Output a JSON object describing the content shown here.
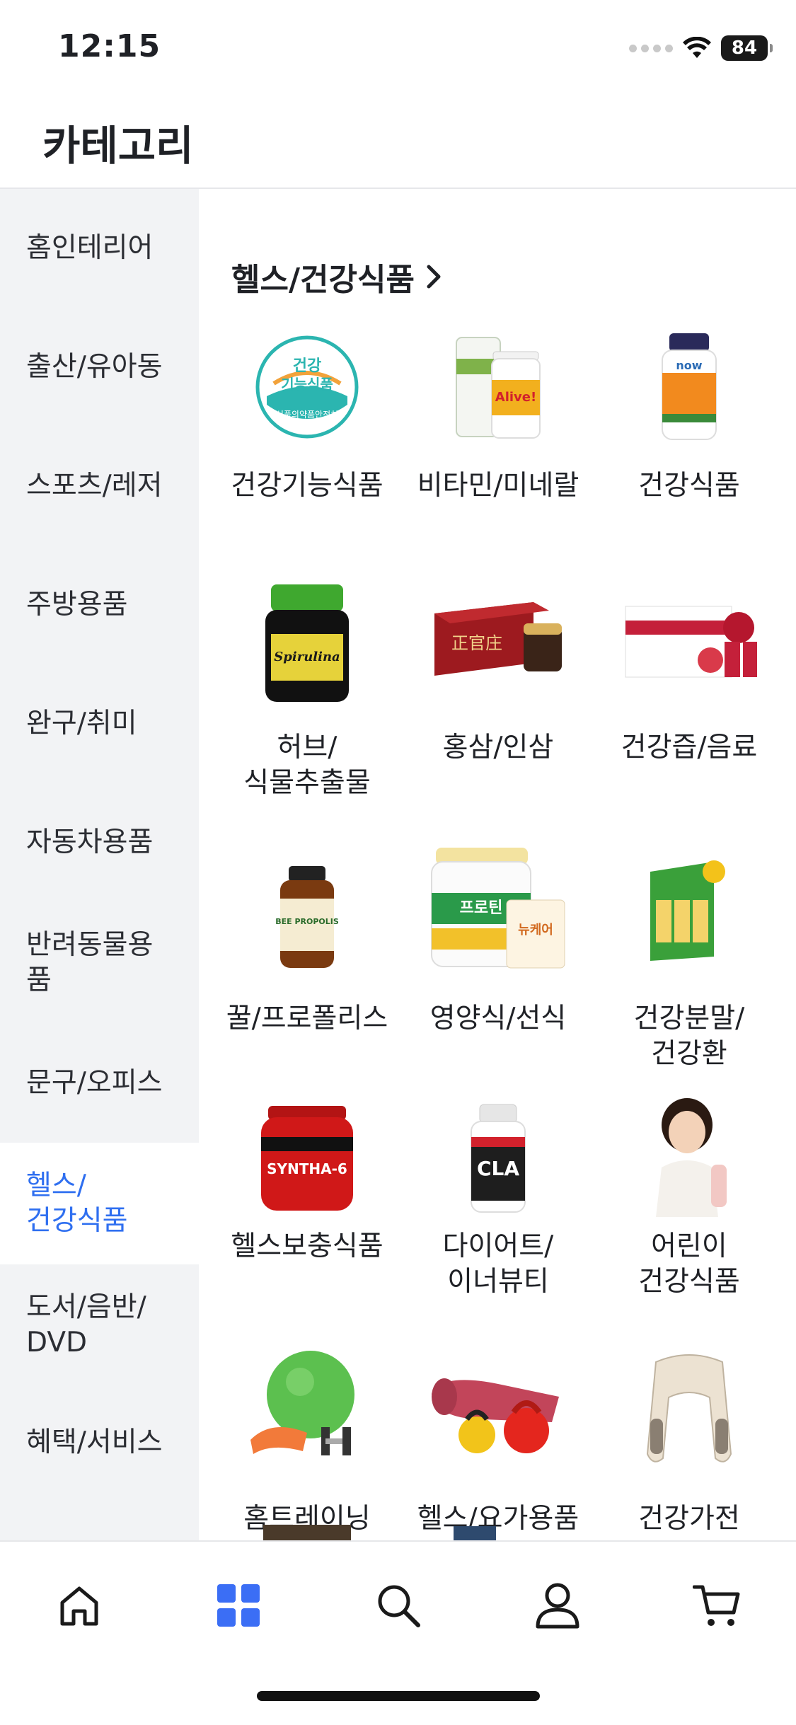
{
  "status_bar": {
    "time": "12:15",
    "battery": "84"
  },
  "header": {
    "title": "카테고리"
  },
  "sidebar": {
    "items": [
      {
        "label": "홈인테리어"
      },
      {
        "label": "출산/유아동"
      },
      {
        "label": "스포츠/레저"
      },
      {
        "label": "주방용품"
      },
      {
        "label": "완구/취미"
      },
      {
        "label": "자동차용품"
      },
      {
        "label": "반려동물용\n품"
      },
      {
        "label": "문구/오피스"
      },
      {
        "label": "헬스/\n건강식품",
        "active": true
      },
      {
        "label": "도서/음반/\nDVD"
      },
      {
        "label": "혜택/서비스"
      }
    ]
  },
  "content": {
    "section_title": "헬스/건강식품",
    "categories": [
      {
        "label": "건강기능식품",
        "icon": "health-food-badge-icon"
      },
      {
        "label": "비타민/미네랄",
        "icon": "vitamin-bottles-icon"
      },
      {
        "label": "건강식품",
        "icon": "supplement-bottle-icon"
      },
      {
        "label": "허브/\n식물추출물",
        "icon": "spirulina-jar-icon"
      },
      {
        "label": "홍삼/인삼",
        "icon": "red-ginseng-box-icon"
      },
      {
        "label": "건강즙/음료",
        "icon": "juice-pack-icon"
      },
      {
        "label": "꿀/프로폴리스",
        "icon": "propolis-bottle-icon"
      },
      {
        "label": "영양식/선식",
        "icon": "protein-can-icon"
      },
      {
        "label": "건강분말/\n건강환",
        "icon": "powder-box-icon"
      },
      {
        "label": "헬스보충식품",
        "icon": "protein-tub-icon"
      },
      {
        "label": "다이어트/\n이너뷰티",
        "icon": "cla-bottle-icon"
      },
      {
        "label": "어린이\n건강식품",
        "icon": "child-icon"
      },
      {
        "label": "홈트레이닝",
        "icon": "gym-ball-icon"
      },
      {
        "label": "헬스/요가용품",
        "icon": "yoga-mat-kettlebell-icon"
      },
      {
        "label": "건강가전",
        "icon": "massager-icon"
      }
    ],
    "badge_text": {
      "health_line1": "건강",
      "health_line2": "기능식품",
      "health_seal": "식품의약품안전처",
      "cla": "CLA",
      "now": "now",
      "alive": "Alive!",
      "spirulina": "Spirulina",
      "synthe": "SYNTHA-6",
      "protein": "프로틴",
      "newcare": "뉴케어",
      "propolis": "BEE PROPOLIS"
    }
  },
  "tabbar": {
    "tabs": [
      {
        "name": "home",
        "active": false
      },
      {
        "name": "category",
        "active": true
      },
      {
        "name": "search",
        "active": false
      },
      {
        "name": "my",
        "active": false
      },
      {
        "name": "cart",
        "active": false
      }
    ],
    "active_color": "#3b6ef5"
  }
}
